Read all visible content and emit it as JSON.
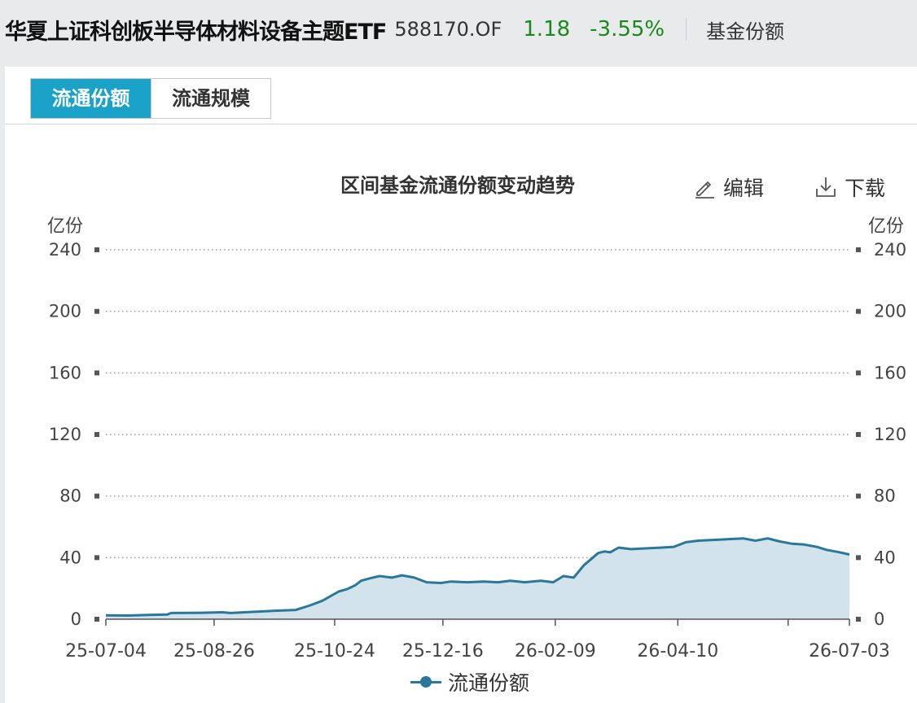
{
  "header": {
    "fund_name": "华夏上证科创板半导体材料设备主题ETF",
    "fund_code": "588170.OF",
    "price": "1.18",
    "change_pct": "-3.55%",
    "section_label": "基金份额"
  },
  "tabs": [
    {
      "label": "流通份额",
      "active": true
    },
    {
      "label": "流通规模",
      "active": false
    }
  ],
  "toolbar": {
    "edit_label": "编辑",
    "download_label": "下载"
  },
  "colors": {
    "accent": "#1aa2c8",
    "line": "#2a7899",
    "area": "#d2e3ec",
    "change": "#1a8a1a"
  },
  "chart_data": {
    "type": "area",
    "title": "区间基金流通份额变动趋势",
    "y_unit_left": "亿份",
    "y_unit_right": "亿份",
    "ylim": [
      0,
      240
    ],
    "yticks": [
      0,
      40,
      80,
      120,
      160,
      200,
      240
    ],
    "xlim": [
      "2025-07-04",
      "2026-07-03"
    ],
    "xticks": [
      "25-07-04",
      "25-08-26",
      "25-10-24",
      "25-12-16",
      "26-02-09",
      "26-04-10",
      "26-07-03"
    ],
    "grid": true,
    "legend_position": "bottom",
    "series": [
      {
        "name": "流通份额",
        "points": [
          [
            "2025-07-04",
            2.5
          ],
          [
            "2025-07-15",
            2.4
          ],
          [
            "2025-07-25",
            2.8
          ],
          [
            "2025-08-03",
            3.0
          ],
          [
            "2025-08-05",
            4.0
          ],
          [
            "2025-08-20",
            4.2
          ],
          [
            "2025-08-30",
            4.5
          ],
          [
            "2025-09-03",
            4.0
          ],
          [
            "2025-09-10",
            4.5
          ],
          [
            "2025-09-25",
            5.5
          ],
          [
            "2025-10-05",
            6.0
          ],
          [
            "2025-10-12",
            9.0
          ],
          [
            "2025-10-18",
            12.0
          ],
          [
            "2025-10-26",
            18.0
          ],
          [
            "2025-10-30",
            19.5
          ],
          [
            "2025-11-03",
            22.0
          ],
          [
            "2025-11-06",
            25.0
          ],
          [
            "2025-11-10",
            26.5
          ],
          [
            "2025-11-15",
            28.0
          ],
          [
            "2025-11-21",
            27.0
          ],
          [
            "2025-11-26",
            28.5
          ],
          [
            "2025-12-02",
            27.0
          ],
          [
            "2025-12-08",
            24.0
          ],
          [
            "2025-12-15",
            23.5
          ],
          [
            "2025-12-20",
            24.5
          ],
          [
            "2025-12-28",
            24.0
          ],
          [
            "2026-01-05",
            24.5
          ],
          [
            "2026-01-12",
            24.0
          ],
          [
            "2026-01-18",
            25.0
          ],
          [
            "2026-01-25",
            24.0
          ],
          [
            "2026-02-02",
            25.0
          ],
          [
            "2026-02-08",
            24.0
          ],
          [
            "2026-02-13",
            28.0
          ],
          [
            "2026-02-18",
            27.0
          ],
          [
            "2026-02-23",
            35.0
          ],
          [
            "2026-03-02",
            43.0
          ],
          [
            "2026-03-05",
            44.0
          ],
          [
            "2026-03-08",
            43.5
          ],
          [
            "2026-03-12",
            46.5
          ],
          [
            "2026-03-18",
            45.5
          ],
          [
            "2026-03-25",
            46.0
          ],
          [
            "2026-04-02",
            46.5
          ],
          [
            "2026-04-08",
            47.0
          ],
          [
            "2026-04-14",
            50.0
          ],
          [
            "2026-04-20",
            51.0
          ],
          [
            "2026-04-27",
            51.5
          ],
          [
            "2026-05-05",
            52.0
          ],
          [
            "2026-05-12",
            52.5
          ],
          [
            "2026-05-18",
            51.0
          ],
          [
            "2026-05-24",
            52.5
          ],
          [
            "2026-05-30",
            50.5
          ],
          [
            "2026-06-05",
            49.0
          ],
          [
            "2026-06-11",
            48.5
          ],
          [
            "2026-06-17",
            47.0
          ],
          [
            "2026-06-22",
            45.0
          ],
          [
            "2026-06-28",
            43.5
          ],
          [
            "2026-07-03",
            42.0
          ]
        ]
      }
    ]
  }
}
